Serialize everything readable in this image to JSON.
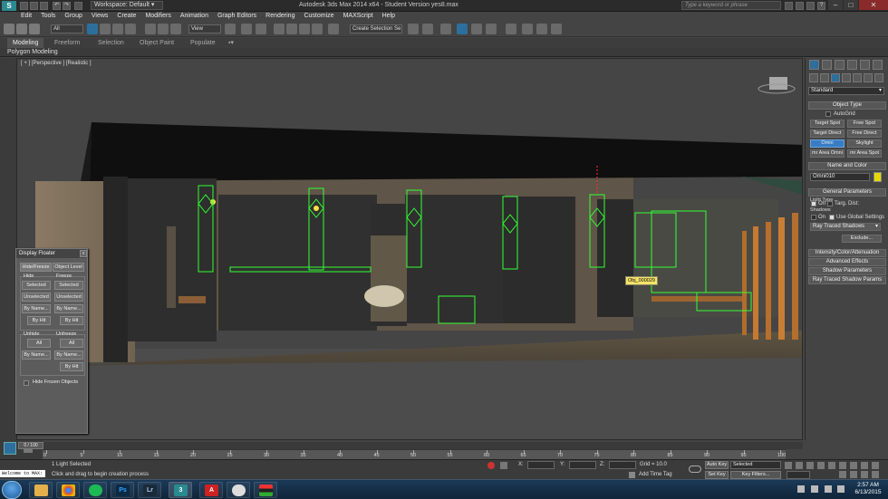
{
  "titlebar": {
    "workspace": "Workspace: Default",
    "title": "Autodesk 3ds Max  2014 x64  -  Student Version     yes8.max",
    "search_placeholder": "Type a keyword or phrase"
  },
  "menu": [
    "Edit",
    "Tools",
    "Group",
    "Views",
    "Create",
    "Modifiers",
    "Animation",
    "Graph Editors",
    "Rendering",
    "Customize",
    "MAXScript",
    "Help"
  ],
  "toolbar": {
    "selection_filter": "All",
    "ref_coord": "View",
    "named_selection_placeholder": "Create Selection Se"
  },
  "ribbon": {
    "tabs": [
      "Modeling",
      "Freeform",
      "Selection",
      "Object Paint",
      "Populate"
    ],
    "active_tab": "Modeling",
    "panel_label": "Polygon Modeling"
  },
  "viewport": {
    "label": "[ + ] [Perspective ] [Realistic ]",
    "tooltip": "Obj_000029"
  },
  "floater": {
    "title": "Display Floater",
    "tab_hide_freeze": "Hide/Freeze",
    "tab_object_level": "Object Level",
    "hide_label": "Hide",
    "freeze_label": "Freeze",
    "selected": "Selected",
    "unselected": "Unselected",
    "by_name": "By Name...",
    "by_hit": "By Hit",
    "unhide_label": "Unhide",
    "unfreeze_label": "Unfreeze",
    "all": "All",
    "hide_frozen": "Hide Frozen Objects"
  },
  "command_panel": {
    "category": "Standard",
    "object_type_title": "Object Type",
    "autogrid": "AutoGrid",
    "light_types": [
      "Target Spot",
      "Free Spot",
      "Target Direct",
      "Free Direct",
      "Omni",
      "Skylight",
      "mr Area Omni",
      "mr Area Spot"
    ],
    "active_light": "Omni",
    "name_color_title": "Name and Color",
    "object_name": "Omni010",
    "object_color": "#e8d800",
    "general_params_title": "General Parameters",
    "light_type_label": "Light Type",
    "on_label": "On",
    "targ_dist": "Targ. Dist:",
    "shadows_label": "Shadows",
    "use_global": "Use Global Settings",
    "shadow_type": "Ray Traced Shadows",
    "exclude": "Exclude...",
    "rollouts": [
      "Intensity/Color/Attenuation",
      "Advanced Effects",
      "Shadow Parameters",
      "Ray Traced Shadow Params"
    ]
  },
  "timeline": {
    "slider_label": "0 / 100",
    "ticks": [
      "0",
      "5",
      "10",
      "15",
      "20",
      "25",
      "30",
      "35",
      "40",
      "45",
      "50",
      "55",
      "60",
      "65",
      "70",
      "75",
      "80",
      "85",
      "90",
      "95",
      "100"
    ]
  },
  "status": {
    "maxscript": "Welcome to MAX:",
    "selection": "1 Light Selected",
    "prompt": "Click and drag to begin creation process",
    "x_label": "X:",
    "y_label": "Y:",
    "z_label": "Z:",
    "grid": "Grid = 10.0",
    "add_time_tag": "Add Time Tag",
    "auto_key": "Auto Key",
    "set_key": "Set Key",
    "key_mode": "Selected",
    "key_filters": "Key Filters..."
  },
  "taskbar": {
    "apps": [
      "explorer",
      "chrome",
      "spotify",
      "photoshop",
      "lightroom",
      "3dsmax",
      "autocad",
      "vlc",
      "email",
      "flag"
    ],
    "time": "2:57 AM",
    "date": "6/13/2015"
  },
  "colors": {
    "accent_blue": "#3a7cc4",
    "select_green": "#33ff33",
    "light_yellow": "#ffe040"
  }
}
